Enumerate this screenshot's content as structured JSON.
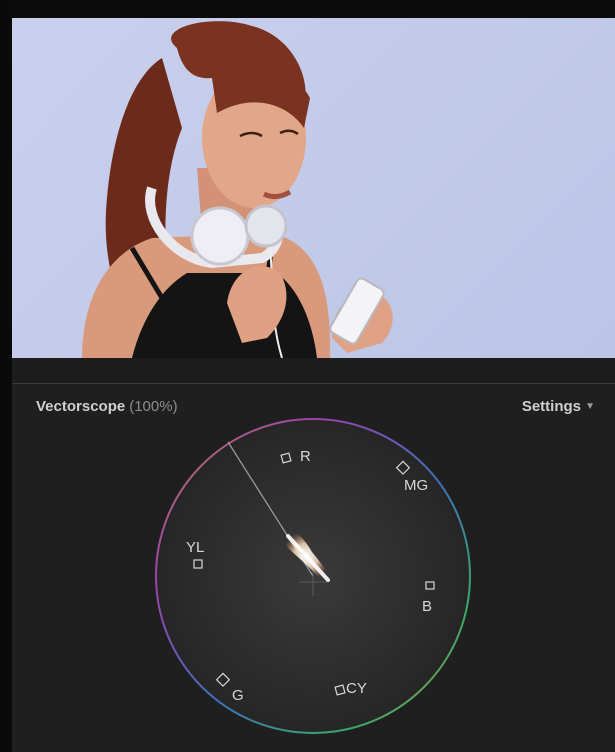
{
  "scope": {
    "title": "Vectorscope",
    "zoom": "(100%)",
    "settings_label": "Settings",
    "settings_arrow": "▼"
  },
  "targets": {
    "r": "R",
    "mg": "MG",
    "yl": "YL",
    "b": "B",
    "g": "G",
    "cy": "CY"
  },
  "colors": {
    "viewer_bg": "#c6cdec",
    "panel_bg": "#1f1f1f",
    "scope_bg": "#2a2a2a"
  }
}
